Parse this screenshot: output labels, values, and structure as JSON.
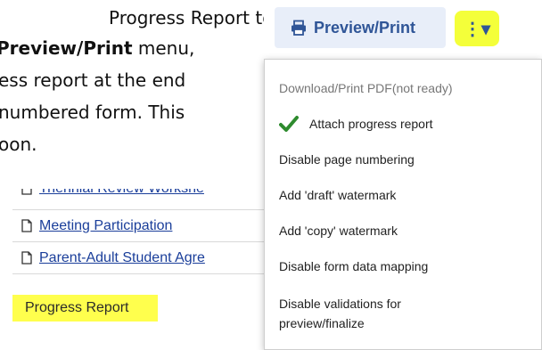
{
  "document": {
    "line1": "Progress Report to the",
    "line2_bold": "Preview/Print",
    "line2_rest": " menu,",
    "line3": "ess report at the end",
    "line4": "numbered form. This",
    "line5": "oon."
  },
  "form_list": {
    "items": [
      {
        "label": "Triennial Review Workshe"
      },
      {
        "label": "Meeting Participation"
      },
      {
        "label": "Parent-Adult Student Agre"
      }
    ],
    "selected_label": "Progress Report"
  },
  "toolbar": {
    "preview_label": "Preview/Print",
    "dropdown_glyph": "⋮▾"
  },
  "menu": {
    "items": [
      {
        "label": "Download/Print PDF(not ready)",
        "disabled": true
      },
      {
        "label": "Attach progress report",
        "checked": true
      },
      {
        "label": "Disable page numbering"
      },
      {
        "label": "Add 'draft' watermark"
      },
      {
        "label": "Add 'copy' watermark"
      },
      {
        "label": "Disable form data mapping"
      },
      {
        "label": "Disable validations for"
      },
      {
        "label": "preview/finalize"
      }
    ]
  },
  "colors": {
    "highlight": "#f4ff3a",
    "link": "#1a3e9a",
    "check": "#2e8b2e",
    "button_text": "#2f5597"
  }
}
